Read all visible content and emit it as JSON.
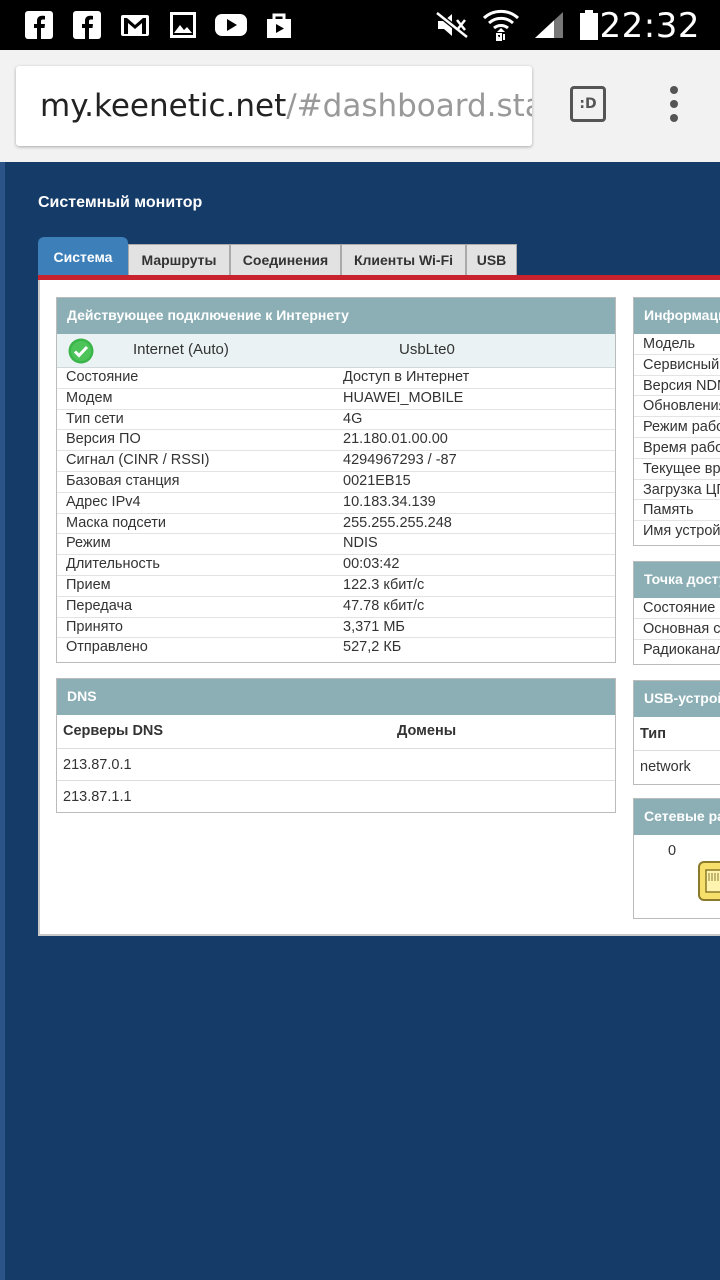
{
  "status_bar": {
    "time": "22:32",
    "icons": [
      "facebook-icon",
      "facebook-icon",
      "gmail-icon",
      "gallery-icon",
      "youtube-icon",
      "store-icon",
      "mute-icon",
      "wifi-icon",
      "signal-icon",
      "battery-icon"
    ]
  },
  "browser": {
    "url_host": "my.keenetic.net",
    "url_path": "/#dashboard.status",
    "tabs_label": ":D"
  },
  "page": {
    "title": "Системный монитор",
    "tabs": [
      {
        "label": "Система",
        "active": true
      },
      {
        "label": "Маршруты"
      },
      {
        "label": "Соединения"
      },
      {
        "label": "Клиенты Wi-Fi"
      },
      {
        "label": "USB"
      }
    ]
  },
  "connection": {
    "title": "Действующее подключение к Интернету",
    "name": "Internet (Auto)",
    "interface": "UsbLte0",
    "rows": [
      {
        "key": "Состояние",
        "value": "Доступ в Интернет"
      },
      {
        "key": "Модем",
        "value": "HUAWEI_MOBILE"
      },
      {
        "key": "Тип сети",
        "value": "4G"
      },
      {
        "key": "Версия ПО",
        "value": "21.180.01.00.00"
      },
      {
        "key": "Сигнал (CINR / RSSI)",
        "value": "4294967293 / -87"
      },
      {
        "key": "Базовая станция",
        "value": "0021EB15"
      },
      {
        "key": "Адрес IPv4",
        "value": "10.183.34.139"
      },
      {
        "key": "Маска подсети",
        "value": "255.255.255.248"
      },
      {
        "key": "Режим",
        "value": "NDIS"
      },
      {
        "key": "Длительность",
        "value": "00:03:42"
      },
      {
        "key": "Прием",
        "value": "122.3 кбит/с"
      },
      {
        "key": "Передача",
        "value": "47.78 кбит/с"
      },
      {
        "key": "Принято",
        "value": "3,371 МБ"
      },
      {
        "key": "Отправлено",
        "value": "527,2 КБ"
      }
    ]
  },
  "dns": {
    "title": "DNS",
    "col_servers": "Серверы DNS",
    "col_domains": "Домены",
    "servers": [
      "213.87.0.1",
      "213.87.1.1"
    ]
  },
  "info": {
    "title": "Информация о системе",
    "rows": [
      "Модель",
      "Сервисный код",
      "Версия NDMS",
      "Обновления",
      "Режим работы",
      "Время работы",
      "Текущее время",
      "Загрузка ЦП",
      "Память",
      "Имя устройства"
    ]
  },
  "access_point": {
    "title": "Точка доступа",
    "rows": [
      "Состояние",
      "Основная сеть",
      "Радиоканал"
    ]
  },
  "usb_devices": {
    "title": "USB-устройства",
    "col_type": "Тип",
    "value": "network"
  },
  "net_ports": {
    "title": "Сетевые разъемы",
    "port_number": "0"
  }
}
